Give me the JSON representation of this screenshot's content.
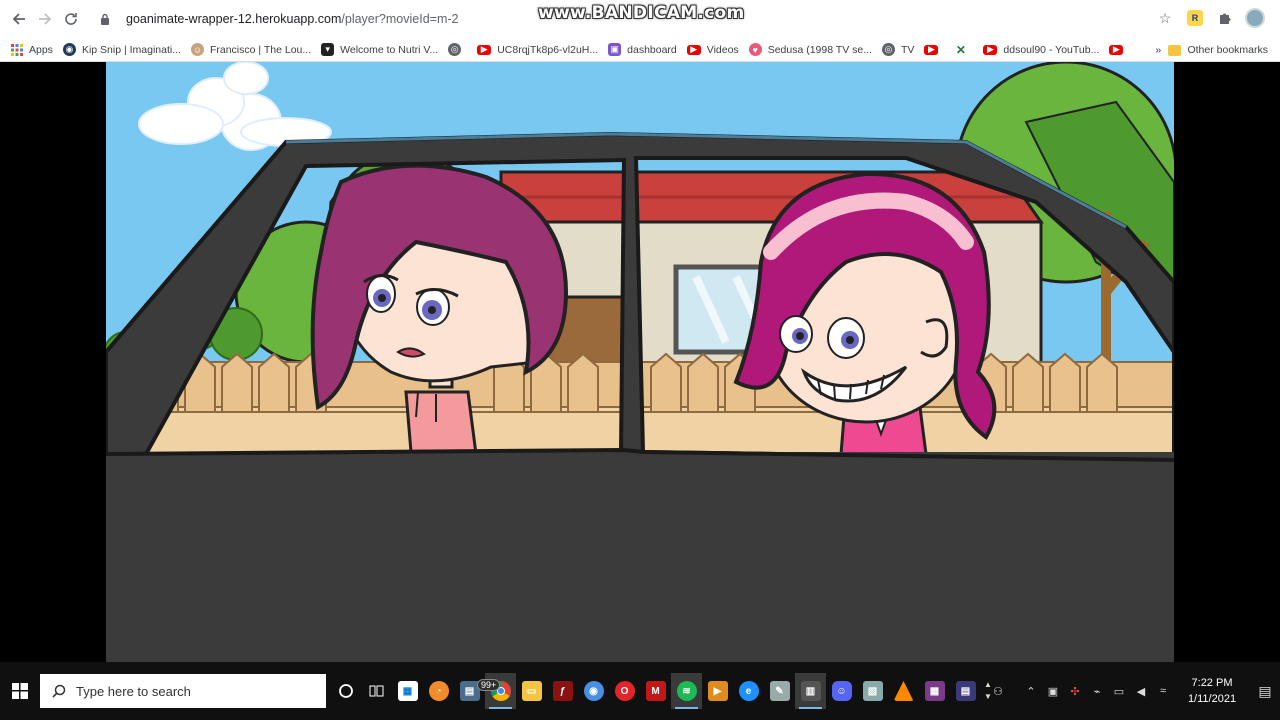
{
  "browser": {
    "url_host": "goanimate-wrapper-12.herokuapp.com",
    "url_path": "/player?movieId=m-2",
    "watermark": "www.BANDICAM.com",
    "accent": "#1a73e8"
  },
  "bookmarks": {
    "apps_label": "Apps",
    "items": [
      {
        "label": "Kip Snip | Imaginati...",
        "icon": "globe-icon"
      },
      {
        "label": "Francisco | The Lou...",
        "icon": "person-icon"
      },
      {
        "label": "Welcome to Nutri V...",
        "icon": "shield-icon"
      },
      {
        "label": "",
        "icon": "globe-icon"
      },
      {
        "label": "UC8rqjTk8p6-vl2uH...",
        "icon": "youtube-icon"
      },
      {
        "label": "dashboard",
        "icon": "dashboard-icon"
      },
      {
        "label": "Videos",
        "icon": "youtube-icon"
      },
      {
        "label": "Sedusa (1998 TV se...",
        "icon": "heart-icon"
      },
      {
        "label": "TV",
        "icon": "globe-icon"
      },
      {
        "label": "",
        "icon": "youtube-icon"
      },
      {
        "label": "",
        "icon": "x-icon"
      },
      {
        "label": "ddsoul90 - YouTub...",
        "icon": "youtube-icon"
      },
      {
        "label": "",
        "icon": "youtube-icon"
      }
    ],
    "overflow": "»",
    "other_label": "Other bookmarks"
  },
  "taskbar": {
    "search_placeholder": "Type here to search",
    "badge": "99+",
    "time": "7:22 PM",
    "date": "1/11/2021"
  }
}
